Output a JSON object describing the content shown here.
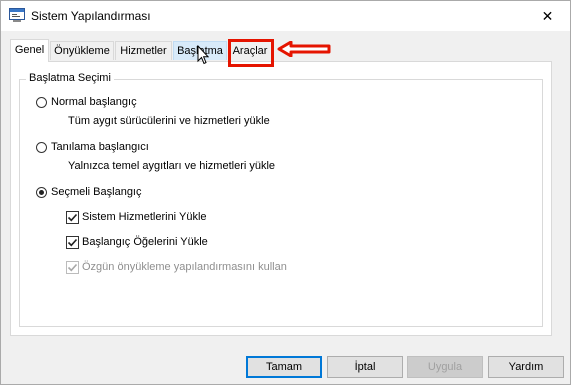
{
  "window": {
    "title": "Sistem Yapılandırması",
    "icon": "msconfig-icon",
    "close_glyph": "✕"
  },
  "tabs": [
    {
      "label": "Genel",
      "active": true
    },
    {
      "label": "Önyükleme"
    },
    {
      "label": "Hizmetler"
    },
    {
      "label": "Başlatma",
      "hover": true
    },
    {
      "label": "Araçlar"
    }
  ],
  "startup_selection": {
    "legend": "Başlatma Seçimi",
    "normal": {
      "label": "Normal başlangıç",
      "description": "Tüm aygıt sürücülerini ve hizmetleri yükle"
    },
    "diagnostic": {
      "label": "Tanılama başlangıcı",
      "description": "Yalnızca temel aygıtları ve hizmetleri yükle"
    },
    "selective": {
      "label": "Seçmeli Başlangıç",
      "selected": true,
      "options": [
        {
          "label": "Sistem Hizmetlerini Yükle",
          "checked": true,
          "enabled": true
        },
        {
          "label": "Başlangıç Öğelerini Yükle",
          "checked": true,
          "enabled": true
        },
        {
          "label": "Özgün önyükleme yapılandırmasını kullan",
          "checked": true,
          "enabled": false
        }
      ]
    }
  },
  "buttons": {
    "ok": "Tamam",
    "cancel": "İptal",
    "apply": "Uygula",
    "help": "Yardım"
  },
  "annotation": {
    "color": "#e51400"
  }
}
